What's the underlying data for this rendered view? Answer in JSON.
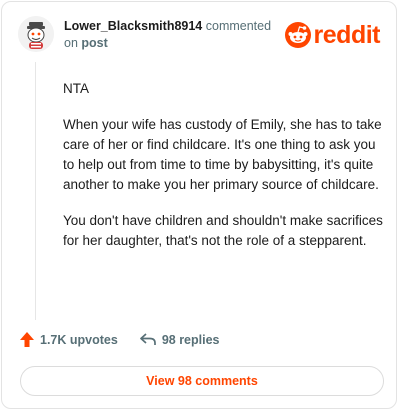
{
  "header": {
    "username": "Lower_Blacksmith8914",
    "action_text": "commented",
    "on_text": "on",
    "post_link": "post"
  },
  "logo": {
    "word": "reddit",
    "icon": "reddit-snoo-icon",
    "color": "#ff4500"
  },
  "comment": {
    "paragraphs": [
      "NTA",
      "When your wife has custody of Emily, she has to take care of her or find childcare. It's one thing to ask you to help out from time to time by babysitting, it's quite another to make you her primary source of childcare.",
      "You don't have children and shouldn't make sacrifices for her daughter, that's not the role of a stepparent."
    ]
  },
  "actions": {
    "upvotes": "1.7K upvotes",
    "upvote_icon": "upvote-arrow-icon",
    "replies": "98 replies",
    "reply_icon": "reply-arrow-icon"
  },
  "view_button": {
    "label": "View 98 comments"
  }
}
